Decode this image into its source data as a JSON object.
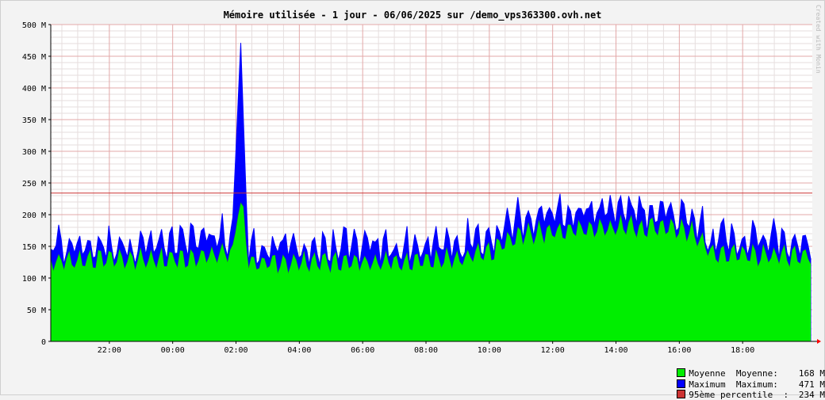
{
  "chart_data": {
    "type": "area",
    "title": "Mémoire utilisée - 1 jour - 06/06/2025 sur /demo_vps363300.ovh.net",
    "watermark": "Created with Monin",
    "y_tick_labels": [
      "0",
      "50 M",
      "100 M",
      "150 M",
      "200 M",
      "250 M",
      "300 M",
      "350 M",
      "400 M",
      "450 M",
      "500 M"
    ],
    "ylim": [
      0,
      500
    ],
    "x_tick_labels": [
      "22:00",
      "00:00",
      "02:00",
      "04:00",
      "06:00",
      "08:00",
      "10:00",
      "12:00",
      "14:00",
      "16:00",
      "18:00"
    ],
    "x_tick_hours": [
      22,
      24,
      26,
      28,
      30,
      32,
      34,
      36,
      38,
      40,
      42
    ],
    "xlim_hours": [
      20.15,
      44.2
    ],
    "grid": true,
    "percentile_line": 234,
    "series": [
      {
        "name": "Moyenne",
        "color": "#00ee00",
        "profile_hours": [
          20.15,
          22,
          24,
          25.9,
          26.1,
          26.25,
          26.4,
          28,
          31,
          33,
          34,
          35,
          36,
          38,
          39.5,
          40.5,
          41,
          43,
          44.2
        ],
        "profile_values": [
          125,
          130,
          130,
          140,
          230,
          190,
          125,
          125,
          125,
          130,
          140,
          170,
          175,
          180,
          180,
          170,
          140,
          135,
          135
        ]
      },
      {
        "name": "Maximum",
        "color": "#0000ff",
        "profile_hours": [
          20.15,
          22,
          24,
          25.9,
          26.05,
          26.15,
          26.25,
          26.4,
          28,
          31,
          33,
          34,
          35,
          36,
          38,
          39.5,
          40.5,
          41,
          43,
          44.2
        ],
        "profile_values": [
          150,
          155,
          155,
          170,
          400,
          460,
          300,
          150,
          150,
          150,
          155,
          165,
          200,
          205,
          210,
          210,
          200,
          165,
          160,
          160
        ]
      },
      {
        "name": "95ème percentile",
        "color": "#cc3333"
      }
    ]
  },
  "legend": [
    {
      "label": "Moyenne  Moyenne:",
      "value": "168 M",
      "color": "#00ee00"
    },
    {
      "label": "Maximum  Maximum:",
      "value": "471 M",
      "color": "#0000ff"
    },
    {
      "label": "95ème percentile  :",
      "value": "234 M",
      "color": "#cc3333"
    }
  ]
}
